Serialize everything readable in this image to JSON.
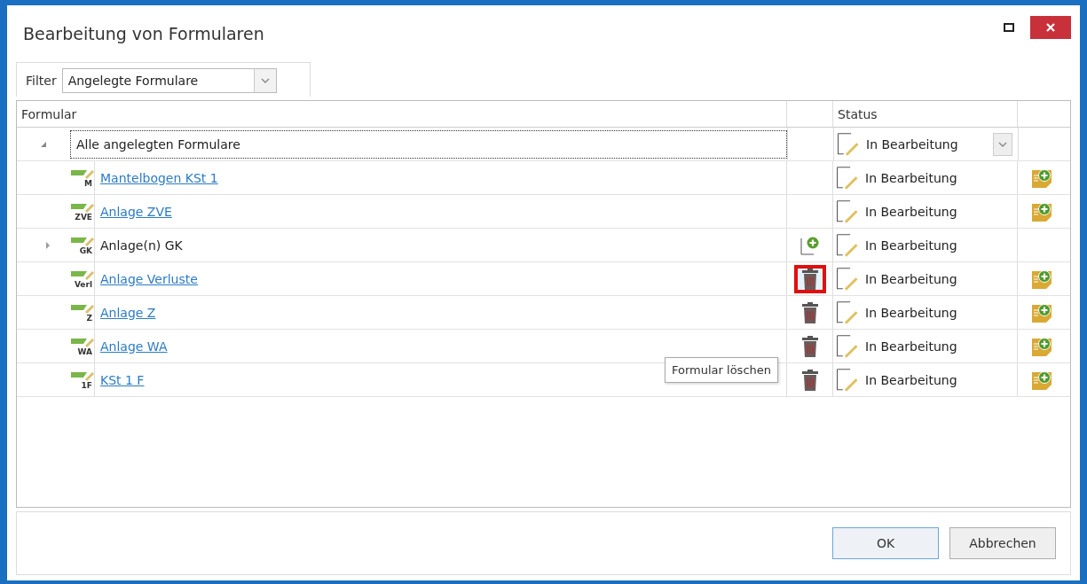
{
  "window": {
    "title": "Bearbeitung von Formularen"
  },
  "filter": {
    "label": "Filter",
    "value": "Angelegte Formulare"
  },
  "table": {
    "columns": [
      "Formular",
      "Status"
    ],
    "root": {
      "label": "Alle angelegten Formulare",
      "expanded": true,
      "status": "In Bearbeitung",
      "children": [
        {
          "code": "M",
          "label": "Mantelbogen KSt 1",
          "link": true,
          "expander": false,
          "kind": "plain",
          "selected": false,
          "status": "In Bearbeitung",
          "note_add": true
        },
        {
          "code": "ZVE",
          "label": "Anlage ZVE",
          "link": true,
          "expander": false,
          "kind": "plain",
          "selected": false,
          "status": "In Bearbeitung",
          "note_add": true
        },
        {
          "code": "GK",
          "label": "Anlage(n) GK",
          "link": false,
          "expander": true,
          "kind": "group",
          "selected": false,
          "status": "In Bearbeitung",
          "note_add": false
        },
        {
          "code": "Verl",
          "label": "Anlage Verluste",
          "link": true,
          "expander": false,
          "kind": "removable",
          "selected": true,
          "status": "In Bearbeitung",
          "note_add": true
        },
        {
          "code": "Z",
          "label": "Anlage Z",
          "link": true,
          "expander": false,
          "kind": "removable",
          "selected": false,
          "status": "In Bearbeitung",
          "note_add": true
        },
        {
          "code": "WA",
          "label": "Anlage WA",
          "link": true,
          "expander": false,
          "kind": "removable",
          "selected": false,
          "status": "In Bearbeitung",
          "note_add": true
        },
        {
          "code": "1F",
          "label": "KSt 1 F",
          "link": true,
          "expander": false,
          "kind": "removable",
          "selected": false,
          "status": "In Bearbeitung",
          "note_add": true
        }
      ]
    }
  },
  "tooltip": {
    "text": "Formular löschen"
  },
  "buttons": [
    {
      "label": "OK",
      "kind": "default"
    },
    {
      "label": "Abbrechen",
      "kind": "normal"
    }
  ]
}
